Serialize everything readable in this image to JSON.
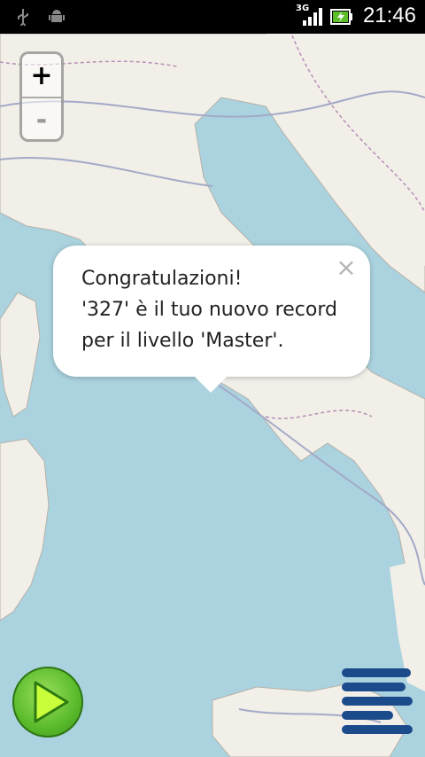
{
  "status_bar": {
    "time": "21:46",
    "network_label": "3G",
    "icons": [
      "usb-icon",
      "android-icon",
      "signal-icon",
      "battery-charging-icon"
    ]
  },
  "zoom": {
    "zoom_in_label": "+",
    "zoom_out_label": "-"
  },
  "popup": {
    "lines": [
      "Congratulazioni!",
      "'327' è il tuo nuovo record",
      "per il livello 'Master'."
    ],
    "close_label": "×"
  },
  "controls": {
    "play_icon": "play-icon",
    "menu_icon": "menu-icon"
  },
  "colors": {
    "sea": "#aad3df",
    "land": "#f2efe9",
    "play_green": "#57b82a",
    "menu_blue": "#1c4b8c"
  }
}
